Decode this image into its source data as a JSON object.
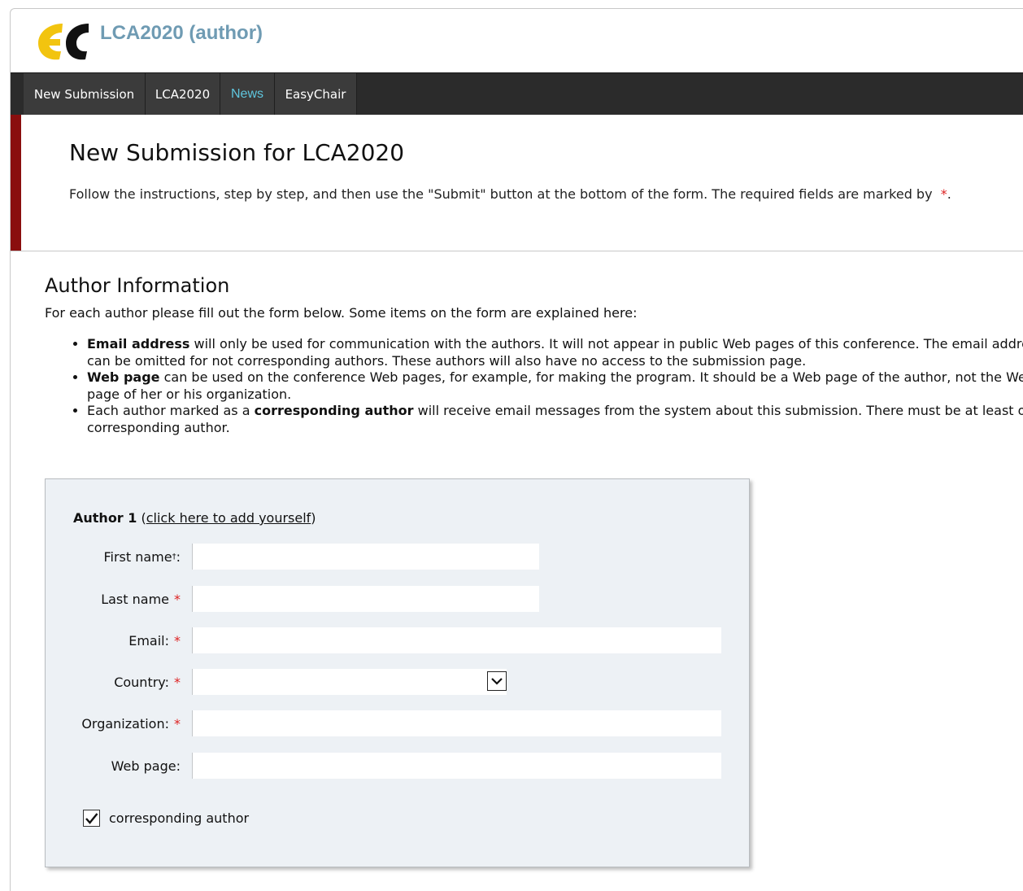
{
  "header": {
    "title": "LCA2020 (author)"
  },
  "nav": {
    "tabs": [
      {
        "label": "New Submission"
      },
      {
        "label": "LCA2020"
      },
      {
        "label": "News"
      },
      {
        "label": "EasyChair"
      }
    ]
  },
  "intro": {
    "title": "New Submission for LCA2020",
    "instructions": "Follow the instructions, step by step, and then use the \"Submit\" button at the bottom of the form. The required fields are marked by",
    "required_marker": "*",
    "period": "."
  },
  "author_info": {
    "title": "Author Information",
    "description": "For each author please fill out the form below. Some items on the form are explained here:",
    "bullets": [
      {
        "bold": "Email address",
        "text": " will only be used for communication with the authors. It will not appear in public Web pages of this conference. The email address can be omitted for not corresponding authors. These authors will also have no access to the submission page."
      },
      {
        "bold": "Web page",
        "text": " can be used on the conference Web pages, for example, for making the program. It should be a Web page of the author, not the Web page of her or his organization."
      },
      {
        "prefix": "Each author marked as a ",
        "bold": "corresponding author",
        "text": " will receive email messages from the system about this submission. There must be at least one corresponding author."
      }
    ]
  },
  "author_form": {
    "heading": "Author 1",
    "add_yourself_open": " (",
    "add_yourself_link": "click here to add yourself",
    "add_yourself_close": ")",
    "fields": {
      "first_name": {
        "label": "First name",
        "sup": "†",
        "suffix": ":",
        "value": ""
      },
      "last_name": {
        "label": "Last name",
        "required": "*",
        "value": ""
      },
      "email": {
        "label": "Email:",
        "required": "*",
        "value": ""
      },
      "country": {
        "label": "Country:",
        "required": "*",
        "value": ""
      },
      "organization": {
        "label": "Organization:",
        "required": "*",
        "value": ""
      },
      "web_page": {
        "label": "Web page:",
        "value": ""
      }
    },
    "corresponding_author": {
      "label": "corresponding author",
      "checked": true
    }
  }
}
